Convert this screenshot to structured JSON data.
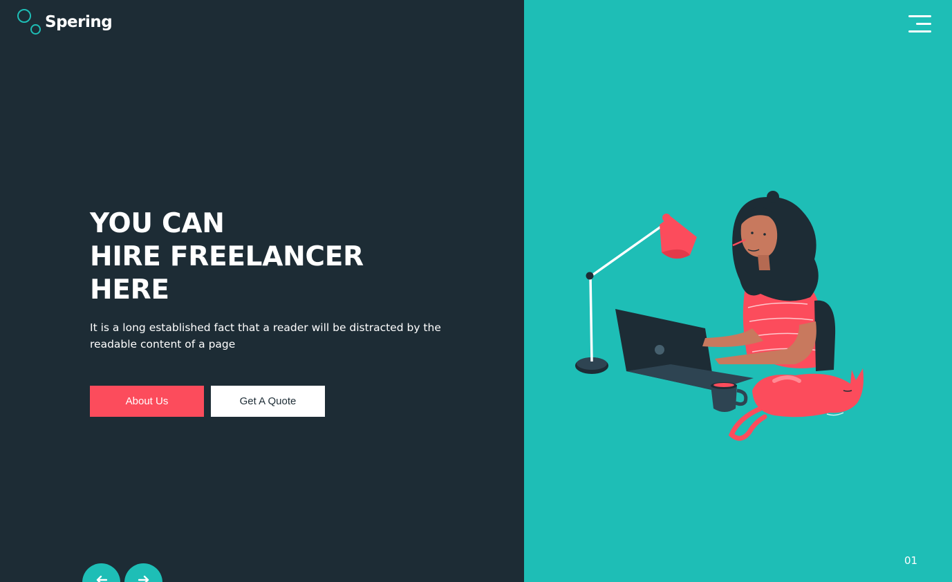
{
  "brand": {
    "name": "Spering",
    "icon": "bubbles-logo-icon"
  },
  "nav": {
    "menu_icon": "hamburger-menu-icon"
  },
  "hero": {
    "title_lines": [
      "YOU CAN",
      "HIRE FREELANCER",
      "HERE"
    ],
    "description": "It is a long established fact that a reader will be distracted by the readable content of a page"
  },
  "buttons": {
    "about_label": "About Us",
    "quote_label": "Get A Quote"
  },
  "slider": {
    "prev_icon": "arrow-left-icon",
    "next_icon": "arrow-right-icon",
    "current": "01"
  },
  "colors": {
    "dark": "#1d2c35",
    "teal": "#1ebeb6",
    "coral": "#fc4c5c",
    "white": "#ffffff"
  },
  "illustration": {
    "subject": "woman-working-on-laptop-with-cat-illustration"
  }
}
